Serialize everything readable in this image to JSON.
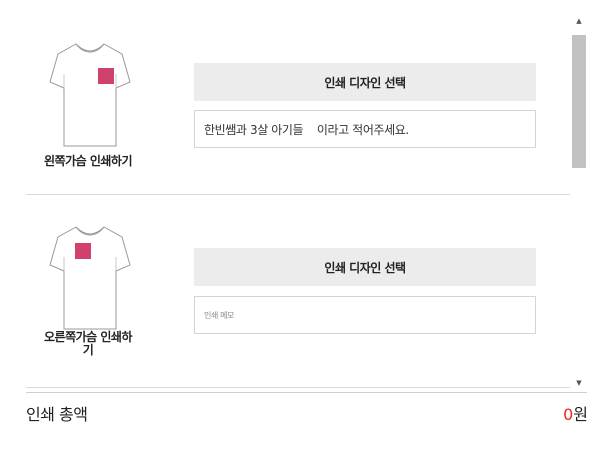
{
  "options": [
    {
      "caption": "왼쪽가슴 인쇄하기",
      "design_button": "인쇄 디자인 선택",
      "memo_value": "한빈쌤과 3살 아기들    이라고 적어주세요.",
      "print_color": "#d0416b"
    },
    {
      "caption_line1": "오른쪽가슴 인쇄하",
      "caption_line2": "기",
      "design_button": "인쇄 디자인 선택",
      "memo_placeholder": "인쇄 메모",
      "print_color": "#d0416b"
    }
  ],
  "total": {
    "label": "인쇄 총액",
    "amount": "0",
    "unit": "원",
    "amount_color": "#e8271e"
  },
  "scrollbar": {
    "up_icon": "triangle-up-icon",
    "down_icon": "triangle-down-icon"
  }
}
